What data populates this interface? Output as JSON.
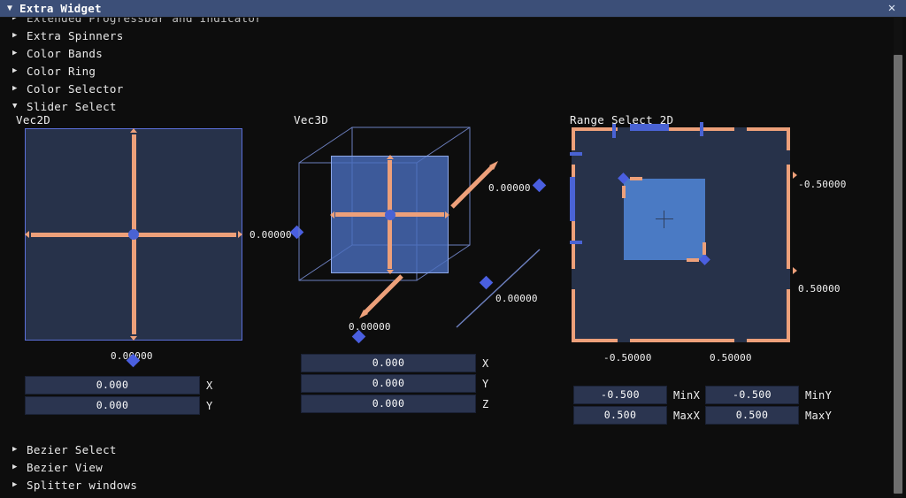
{
  "window": {
    "title": "Extra Widget",
    "expand_icon": "triangle-down-icon",
    "close_icon": "close-icon"
  },
  "tree": {
    "top_items": [
      {
        "label": "Extended Progressbar and Indicator",
        "state": "collapsed",
        "occluded": true
      },
      {
        "label": "Extra Spinners",
        "state": "collapsed"
      },
      {
        "label": "Color Bands",
        "state": "collapsed"
      },
      {
        "label": "Color Ring",
        "state": "collapsed"
      },
      {
        "label": "Color Selector",
        "state": "collapsed"
      },
      {
        "label": "Slider Select",
        "state": "expanded"
      }
    ],
    "bottom_items": [
      {
        "label": "Bezier Select",
        "state": "collapsed"
      },
      {
        "label": "Bezier View",
        "state": "collapsed"
      },
      {
        "label": "Splitter windows",
        "state": "collapsed"
      }
    ]
  },
  "vec2d": {
    "title": "Vec2D",
    "readout_x": "0.00000",
    "readout_y": "0.00000",
    "fields": [
      {
        "value": "0.000",
        "label": "X"
      },
      {
        "value": "0.000",
        "label": "Y"
      }
    ]
  },
  "vec3d": {
    "title": "Vec3D",
    "readout_x": "0.00000",
    "readout_y": "0.00000",
    "readout_z": "0.00000",
    "fields": [
      {
        "value": "0.000",
        "label": "X"
      },
      {
        "value": "0.000",
        "label": "Y"
      },
      {
        "value": "0.000",
        "label": "Z"
      }
    ]
  },
  "range2d": {
    "title": "Range Select 2D",
    "axis_right_top": "-0.50000",
    "axis_right_bottom": "0.50000",
    "axis_bottom_left": "-0.50000",
    "axis_bottom_right": "0.50000",
    "fields": [
      {
        "value": "-0.500",
        "label": "MinX"
      },
      {
        "value": "-0.500",
        "label": "MinY"
      },
      {
        "value": "0.500",
        "label": "MaxX"
      },
      {
        "value": "0.500",
        "label": "MaxY"
      }
    ]
  },
  "colors": {
    "titlebar": "#3c4f78",
    "background": "#0d0d0d",
    "panel_fill": "#27324a",
    "panel_border": "#5b6fd8",
    "slider_orange": "#eda07a",
    "handle_blue": "#4a5fe0",
    "selection_blue": "#4a7ac4",
    "input_fill": "#2b3550",
    "scrollbar": "#6e6e6e"
  }
}
